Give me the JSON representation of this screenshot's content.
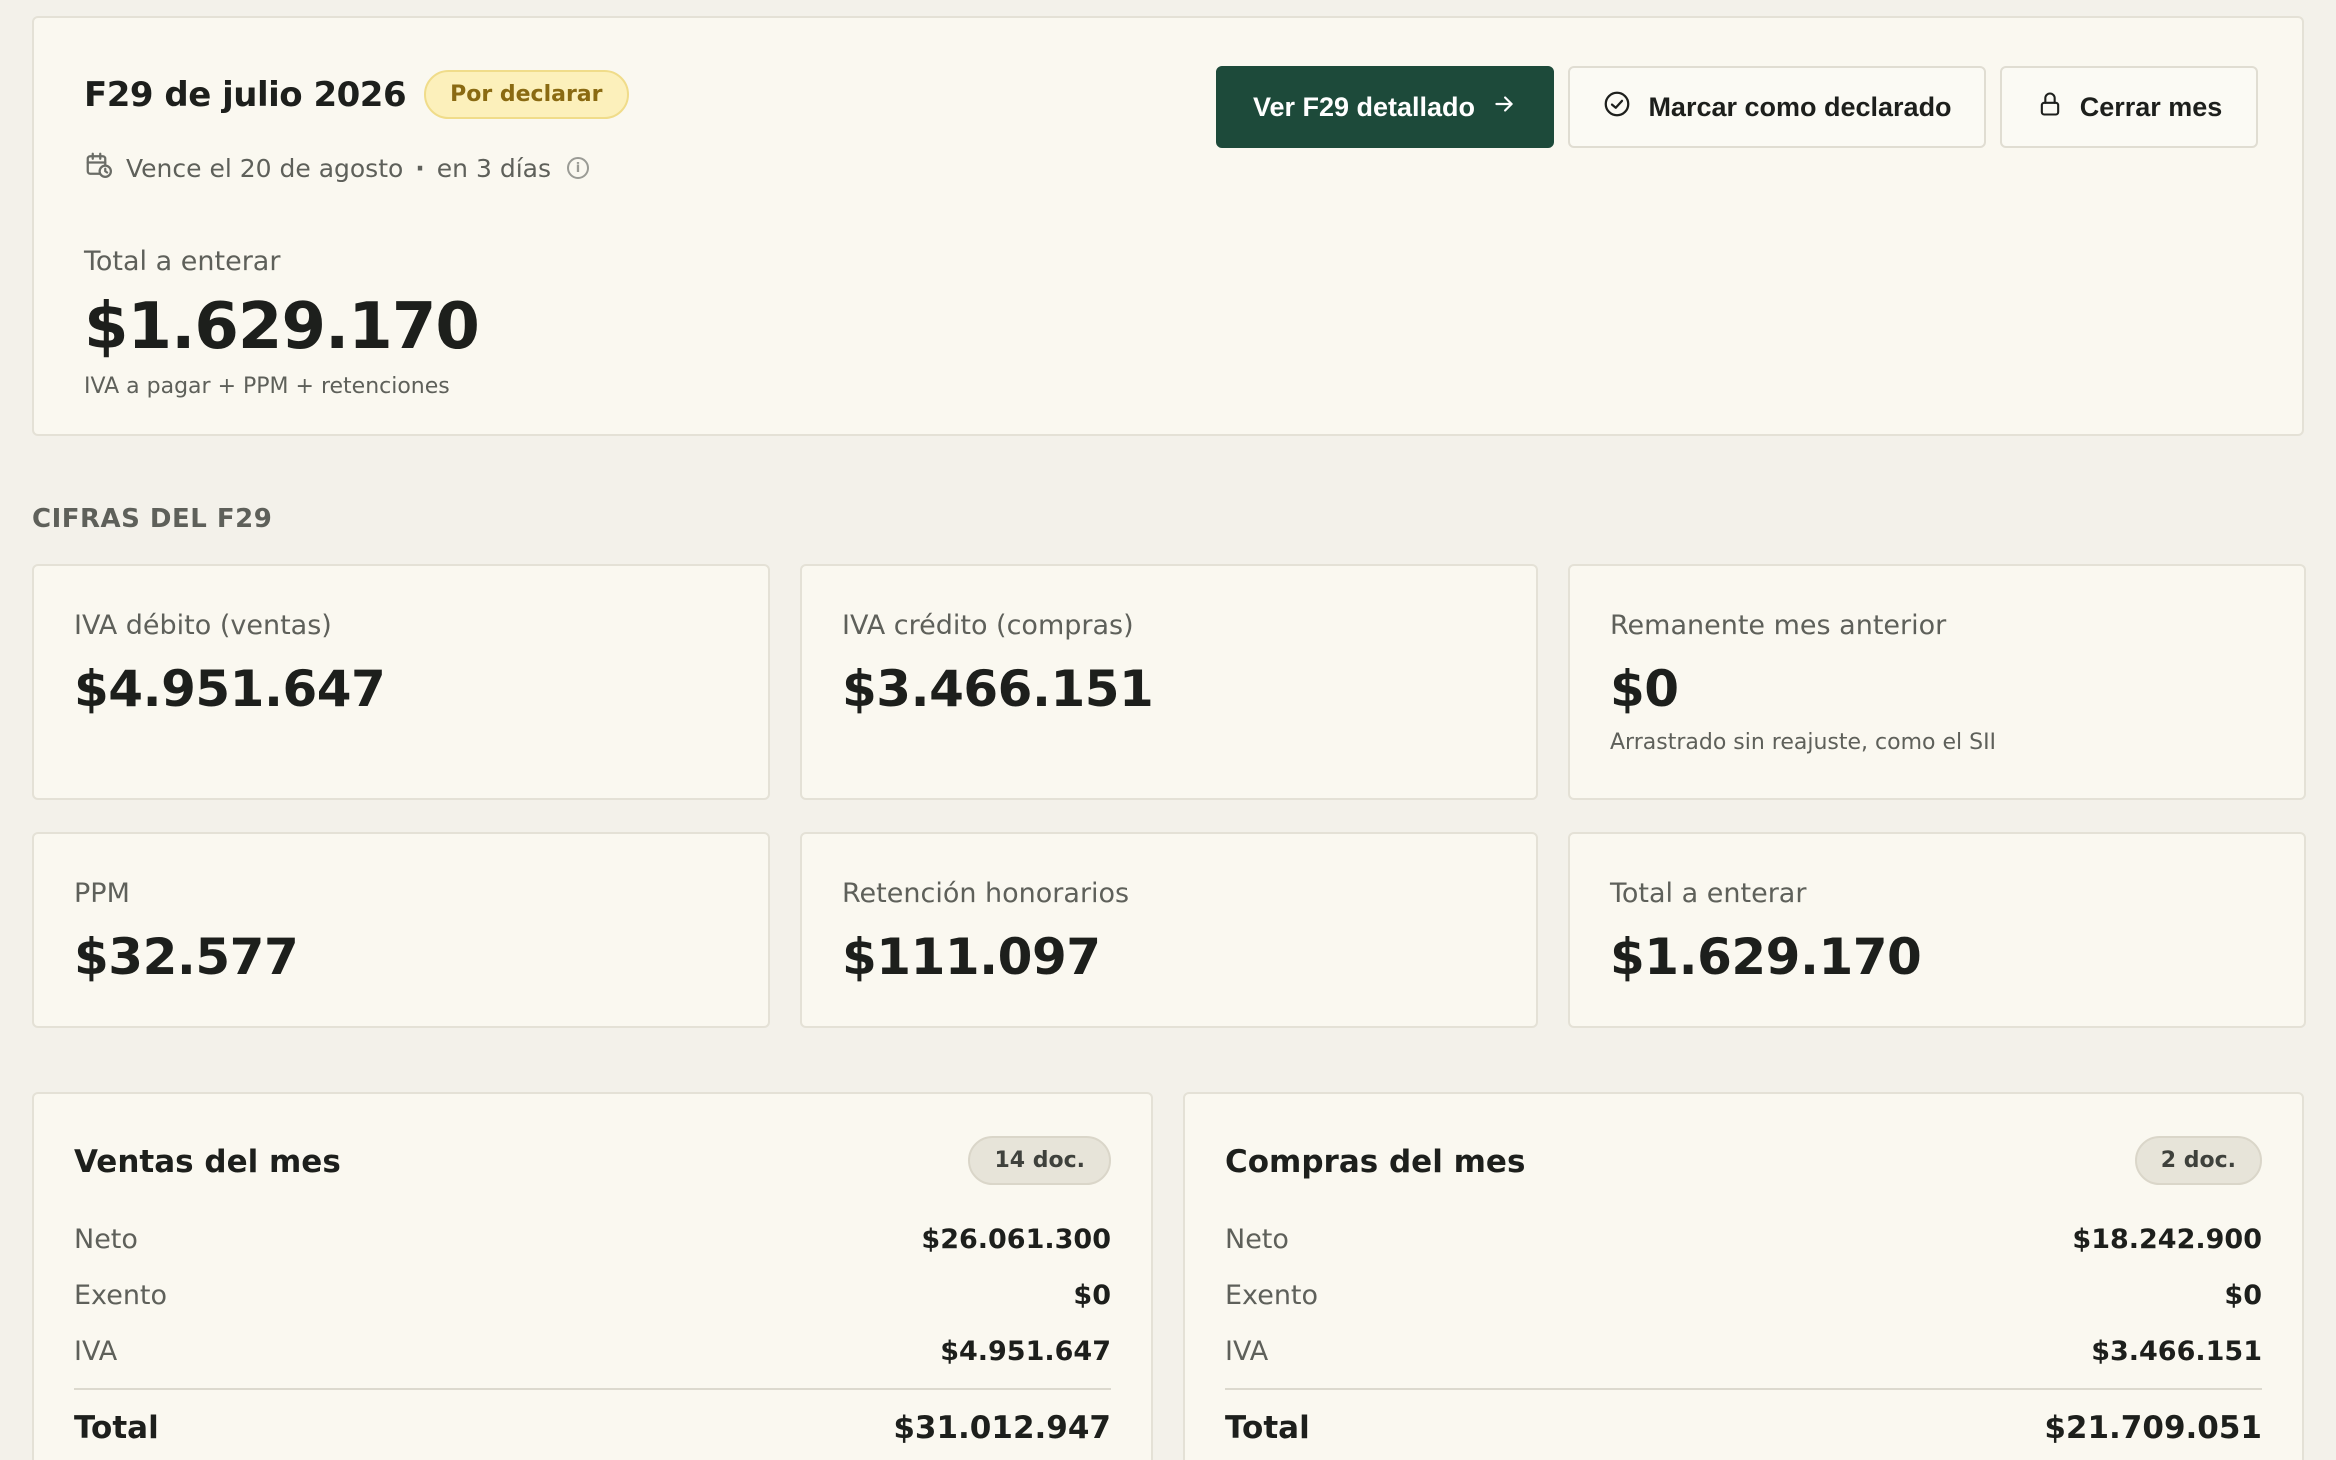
{
  "header": {
    "title": "F29 de julio 2026",
    "status_badge": "Por declarar",
    "due_text": "Vence el 20 de agosto",
    "due_sep": "·",
    "due_relative": "en 3 días",
    "total_label": "Total a enterar",
    "total_value": "$1.629.170",
    "total_note": "IVA a pagar + PPM + retenciones",
    "actions": {
      "view_detail": "Ver F29 detallado",
      "mark_declared": "Marcar como declarado",
      "close_month": "Cerrar mes"
    }
  },
  "figures": {
    "section_title": "CIFRAS DEL F29",
    "cards": [
      {
        "label": "IVA débito (ventas)",
        "value": "$4.951.647",
        "note": ""
      },
      {
        "label": "IVA crédito (compras)",
        "value": "$3.466.151",
        "note": ""
      },
      {
        "label": "Remanente mes anterior",
        "value": "$0",
        "note": "Arrastrado sin reajuste, como el SII"
      },
      {
        "label": "PPM",
        "value": "$32.577",
        "note": ""
      },
      {
        "label": "Retención honorarios",
        "value": "$111.097",
        "note": ""
      },
      {
        "label": "Total a enterar",
        "value": "$1.629.170",
        "note": ""
      }
    ]
  },
  "sales": {
    "title": "Ventas del mes",
    "doc_count": "14 doc.",
    "rows": [
      {
        "label": "Neto",
        "value": "$26.061.300"
      },
      {
        "label": "Exento",
        "value": "$0"
      },
      {
        "label": "IVA",
        "value": "$4.951.647"
      }
    ],
    "total_label": "Total",
    "total_value": "$31.012.947"
  },
  "purchases": {
    "title": "Compras del mes",
    "doc_count": "2 doc.",
    "rows": [
      {
        "label": "Neto",
        "value": "$18.242.900"
      },
      {
        "label": "Exento",
        "value": "$0"
      },
      {
        "label": "IVA",
        "value": "$3.466.151"
      }
    ],
    "total_label": "Total",
    "total_value": "$21.709.051"
  },
  "icons": {
    "calendar": "calendar-clock-icon",
    "info": "info-icon",
    "arrow": "arrow-right-icon",
    "check": "check-circle-icon",
    "lock": "lock-icon"
  },
  "colors": {
    "background": "#f3f1ea",
    "card": "#faf8f0",
    "primary": "#1d4a3a",
    "badge_pending_bg": "#fcf0bb",
    "badge_pending_text": "#8a6a12"
  }
}
